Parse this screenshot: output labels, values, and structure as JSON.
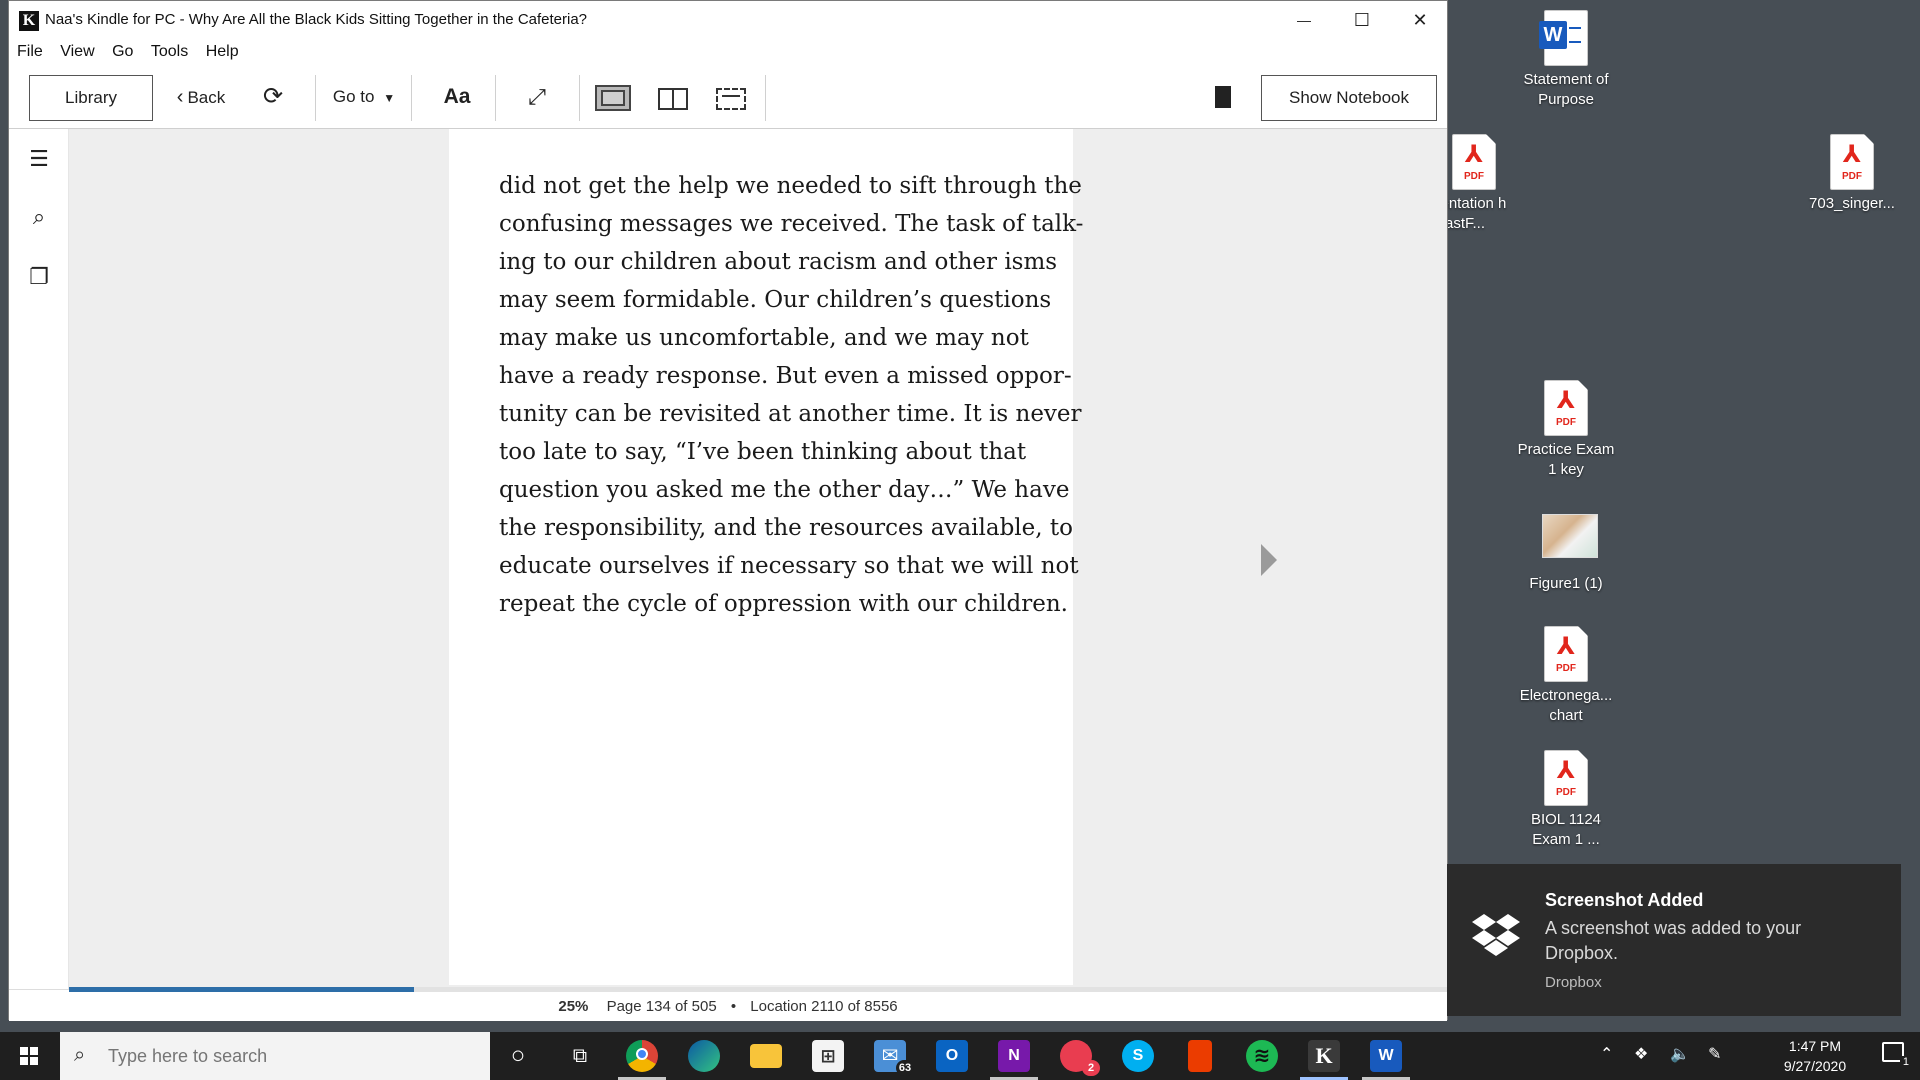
{
  "window": {
    "title": "Naa's Kindle for PC - Why Are All the Black Kids Sitting Together in the Cafeteria?",
    "app_icon_letter": "K",
    "minimize": "—",
    "maximize": "☐",
    "close": "✕"
  },
  "menu": [
    "File",
    "View",
    "Go",
    "Tools",
    "Help"
  ],
  "toolbar": {
    "library": "Library",
    "back": "Back",
    "goto": "Go to",
    "font": "Aa",
    "show_notebook": "Show Notebook"
  },
  "page_text": [
    "did not get the help we needed to sift through the",
    "confusing messages we received. The task of talk-",
    "ing to our children about racism and other isms",
    "may seem formidable. Our children’s questions",
    "may make us uncomfortable, and we may not",
    "have a ready response. But even a missed oppor-",
    "tunity can be revisited at another time. It is never",
    "too late to say, “I’ve been thinking about that",
    "question you asked me the other day…” We have",
    "the responsibility, and the resources available, to",
    "educate ourselves if necessary so that we will not",
    "repeat the cycle of oppression with our children."
  ],
  "status": {
    "percent": "25%",
    "page": "Page 134 of 505",
    "separator": "•",
    "location": "Location 2110 of 8556",
    "progress_fraction": 0.25
  },
  "desktop_icons": [
    {
      "label": "Statement of Purpose",
      "type": "word"
    },
    {
      "label": "mentation h YeastF...",
      "type": "pdf"
    },
    {
      "label": "703_singer...",
      "type": "pdf"
    },
    {
      "label": "Practice Exam 1 key",
      "type": "pdf"
    },
    {
      "label": "Figure1 (1)",
      "type": "image"
    },
    {
      "label": "Electronega... chart",
      "type": "pdf"
    },
    {
      "label": "BIOL 1124 Exam 1 ...",
      "type": "pdf"
    }
  ],
  "pdf_tag": "PDF",
  "toast": {
    "title": "Screenshot Added",
    "body": "A screenshot was added to your Dropbox.",
    "source": "Dropbox"
  },
  "taskbar": {
    "search_placeholder": "Type here to search",
    "mail_badge": "63",
    "mail_letter": "O",
    "onenote_letter": "N",
    "skype_letter": "S",
    "kindle_letter": "K",
    "word_letter": "W",
    "notification_badge": "2",
    "action_center_badge": "1",
    "time": "1:47 PM",
    "date": "9/27/2020"
  },
  "colors": {
    "progress": "#2d6ea8",
    "desktop": "#474e55",
    "taskbar": "#1f1f1f",
    "toast": "#2b2b2b"
  }
}
